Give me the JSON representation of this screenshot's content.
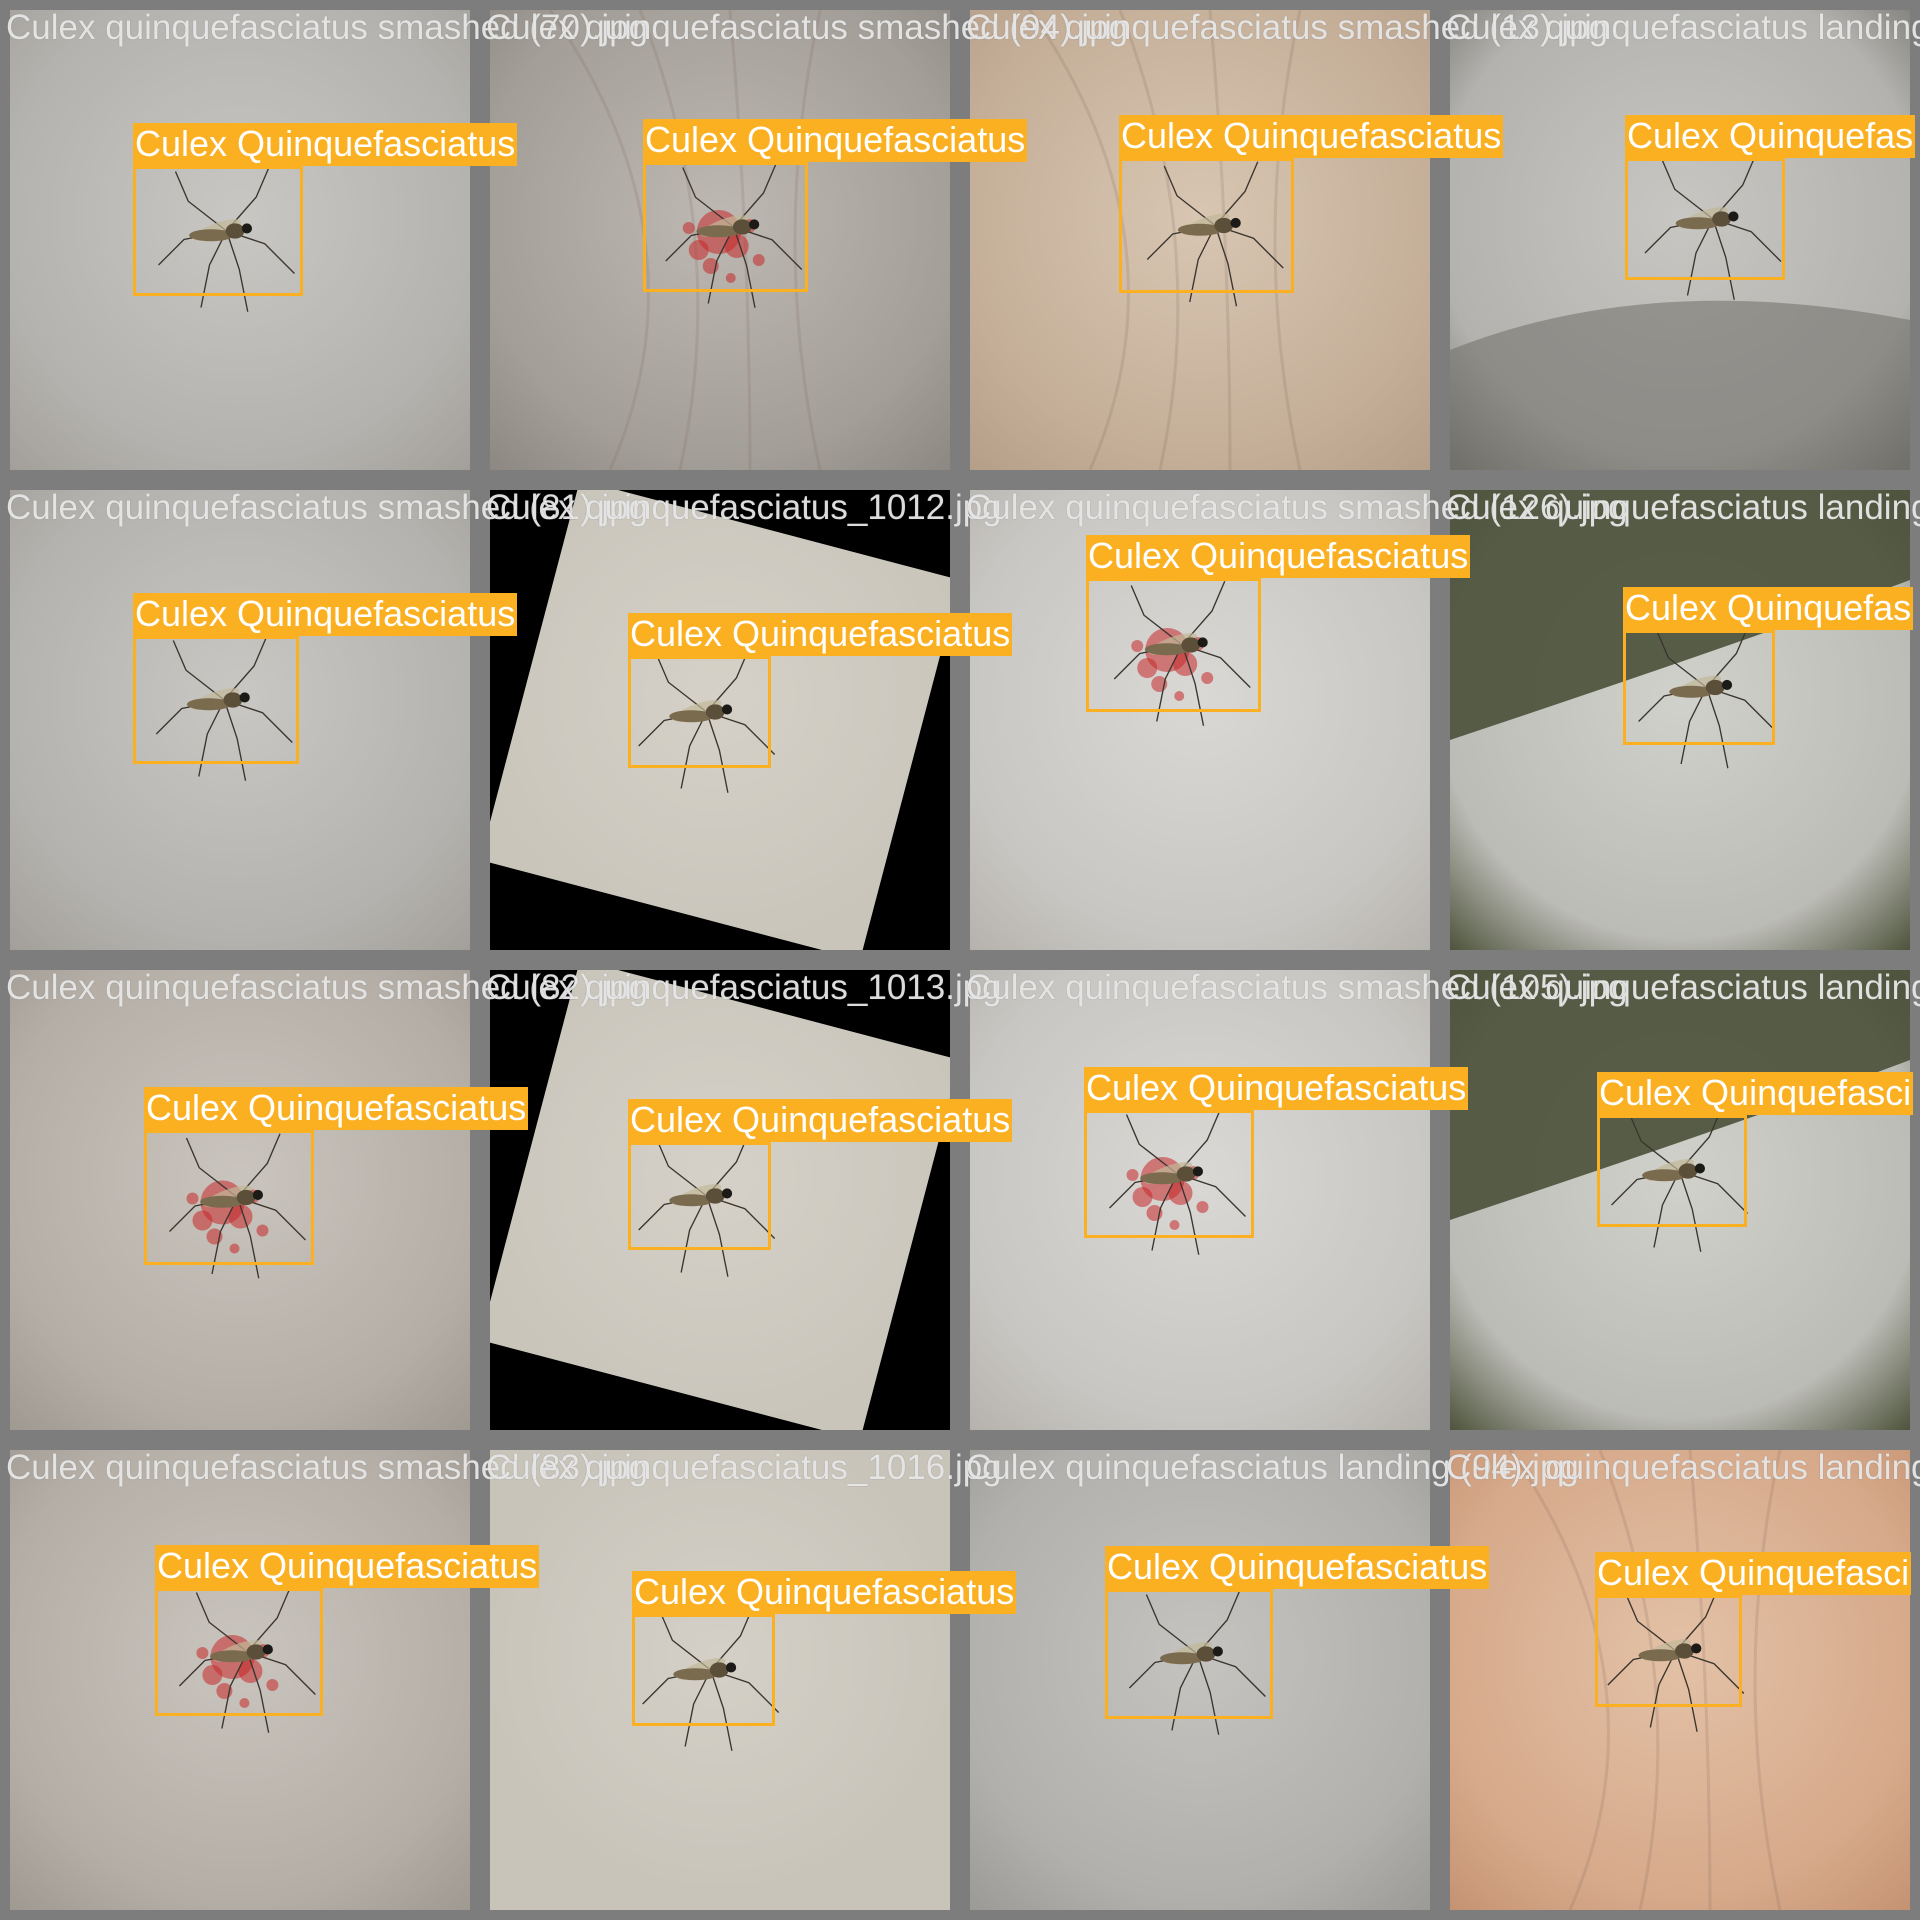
{
  "grid": {
    "rows": 4,
    "cols": 4
  },
  "colors": {
    "box": "#fbb022",
    "tile_border": "#7d7d7d",
    "filename_text": "#ebebeb"
  },
  "tiles": [
    {
      "filename": "Culex quinquefasciatus smashed (70).jpg",
      "label": "Culex Quinquefasciatus",
      "scene": "pale-skin",
      "blood": false
    },
    {
      "filename": "Culex quinquefasciatus smashed (94).jpg",
      "label": "Culex Quinquefasciatus",
      "scene": "palm-grey",
      "blood": true
    },
    {
      "filename": "Culex quinquefasciatus smashed (13).jpg",
      "label": "Culex Quinquefasciatus",
      "scene": "palm-warm",
      "blood": false
    },
    {
      "filename": "Culex quinquefasciatus landing",
      "label": "Culex Quinquefas",
      "scene": "skin-dark-edge",
      "blood": false
    },
    {
      "filename": "Culex quinquefasciatus smashed (81).jpg",
      "label": "Culex Quinquefasciatus",
      "scene": "pale-skin",
      "blood": false
    },
    {
      "filename": "Culex quinquefasciatus_1012.jpg",
      "label": "Culex Quinquefasciatus",
      "scene": "paper-rotated",
      "blood": false
    },
    {
      "filename": "Culex quinquefasciatus smashed (126).jpg",
      "label": "Culex Quinquefasciatus",
      "scene": "skin-light",
      "blood": true
    },
    {
      "filename": "Culex quinquefasciatus landing",
      "label": "Culex Quinquefas",
      "scene": "skin-green-top",
      "blood": false
    },
    {
      "filename": "Culex quinquefasciatus smashed (82).jpg",
      "label": "Culex Quinquefasciatus",
      "scene": "skin-textured",
      "blood": true
    },
    {
      "filename": "Culex quinquefasciatus_1013.jpg",
      "label": "Culex Quinquefasciatus",
      "scene": "paper-rotated",
      "blood": false
    },
    {
      "filename": "Culex quinquefasciatus smashed (105).jpg",
      "label": "Culex Quinquefasciatus",
      "scene": "skin-light",
      "blood": true
    },
    {
      "filename": "Culex quinquefasciatus landing",
      "label": "Culex Quinquefasci",
      "scene": "skin-green-top",
      "blood": false
    },
    {
      "filename": "Culex quinquefasciatus smashed (83).jpg",
      "label": "Culex Quinquefasciatus",
      "scene": "skin-textured",
      "blood": true
    },
    {
      "filename": "Culex quinquefasciatus_1016.jpg",
      "label": "Culex Quinquefasciatus",
      "scene": "paper",
      "blood": false
    },
    {
      "filename": "Culex quinquefasciatus landing (94).jpg",
      "label": "Culex Quinquefasciatus",
      "scene": "grey-skin",
      "blood": false
    },
    {
      "filename": "Culex quinquefasciatus landing",
      "label": "Culex Quinquefasci",
      "scene": "palm-pink",
      "blood": false
    }
  ]
}
